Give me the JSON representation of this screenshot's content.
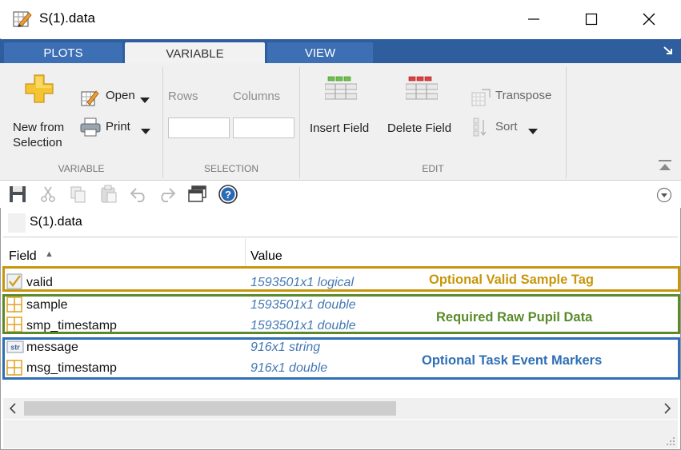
{
  "window": {
    "title": "S(1).data",
    "minimize_icon": "minimize-icon",
    "maximize_icon": "maximize-icon",
    "close_icon": "close-icon"
  },
  "tabs": [
    {
      "label": "PLOTS",
      "active": false
    },
    {
      "label": "VARIABLE",
      "active": true
    },
    {
      "label": "VIEW",
      "active": false
    }
  ],
  "ribbon": {
    "variable_section": {
      "label": "VARIABLE",
      "new_from_selection_line1": "New from",
      "new_from_selection_line2": "Selection",
      "open_label": "Open",
      "print_label": "Print"
    },
    "selection_section": {
      "label": "SELECTION",
      "rows_label": "Rows",
      "columns_label": "Columns",
      "rows_value": "",
      "columns_value": ""
    },
    "edit_section": {
      "label": "EDIT",
      "insert_field_label": "Insert Field",
      "delete_field_label": "Delete Field",
      "transpose_label": "Transpose",
      "sort_label": "Sort"
    }
  },
  "quick_access": [
    "save-icon",
    "cut-icon",
    "copy-icon",
    "paste-icon",
    "undo-icon",
    "redo-icon",
    "dock-window-icon",
    "help-icon"
  ],
  "address": {
    "path": "S(1).data"
  },
  "table": {
    "columns": [
      "Field",
      "Value"
    ],
    "rows": [
      {
        "icon": "checkbox-icon",
        "field": "valid",
        "value": "1593501x1 logical"
      },
      {
        "icon": "grid-icon",
        "field": "sample",
        "value": "1593501x1 double"
      },
      {
        "icon": "grid-icon",
        "field": "smp_timestamp",
        "value": "1593501x1 double"
      },
      {
        "icon": "str-icon",
        "field": "message",
        "value": "916x1 string",
        "icon_text": "str"
      },
      {
        "icon": "grid-icon",
        "field": "msg_timestamp",
        "value": "916x1 double"
      }
    ]
  },
  "annotations": [
    {
      "label": "Optional Valid Sample Tag",
      "color": "#c8960a"
    },
    {
      "label": "Required Raw Pupil Data",
      "color": "#5a8a2a"
    },
    {
      "label": "Optional Task Event Markers",
      "color": "#2e6fb5"
    }
  ],
  "colors": {
    "tab_strip": "#2f5e9f",
    "value_text": "#4579b6"
  }
}
